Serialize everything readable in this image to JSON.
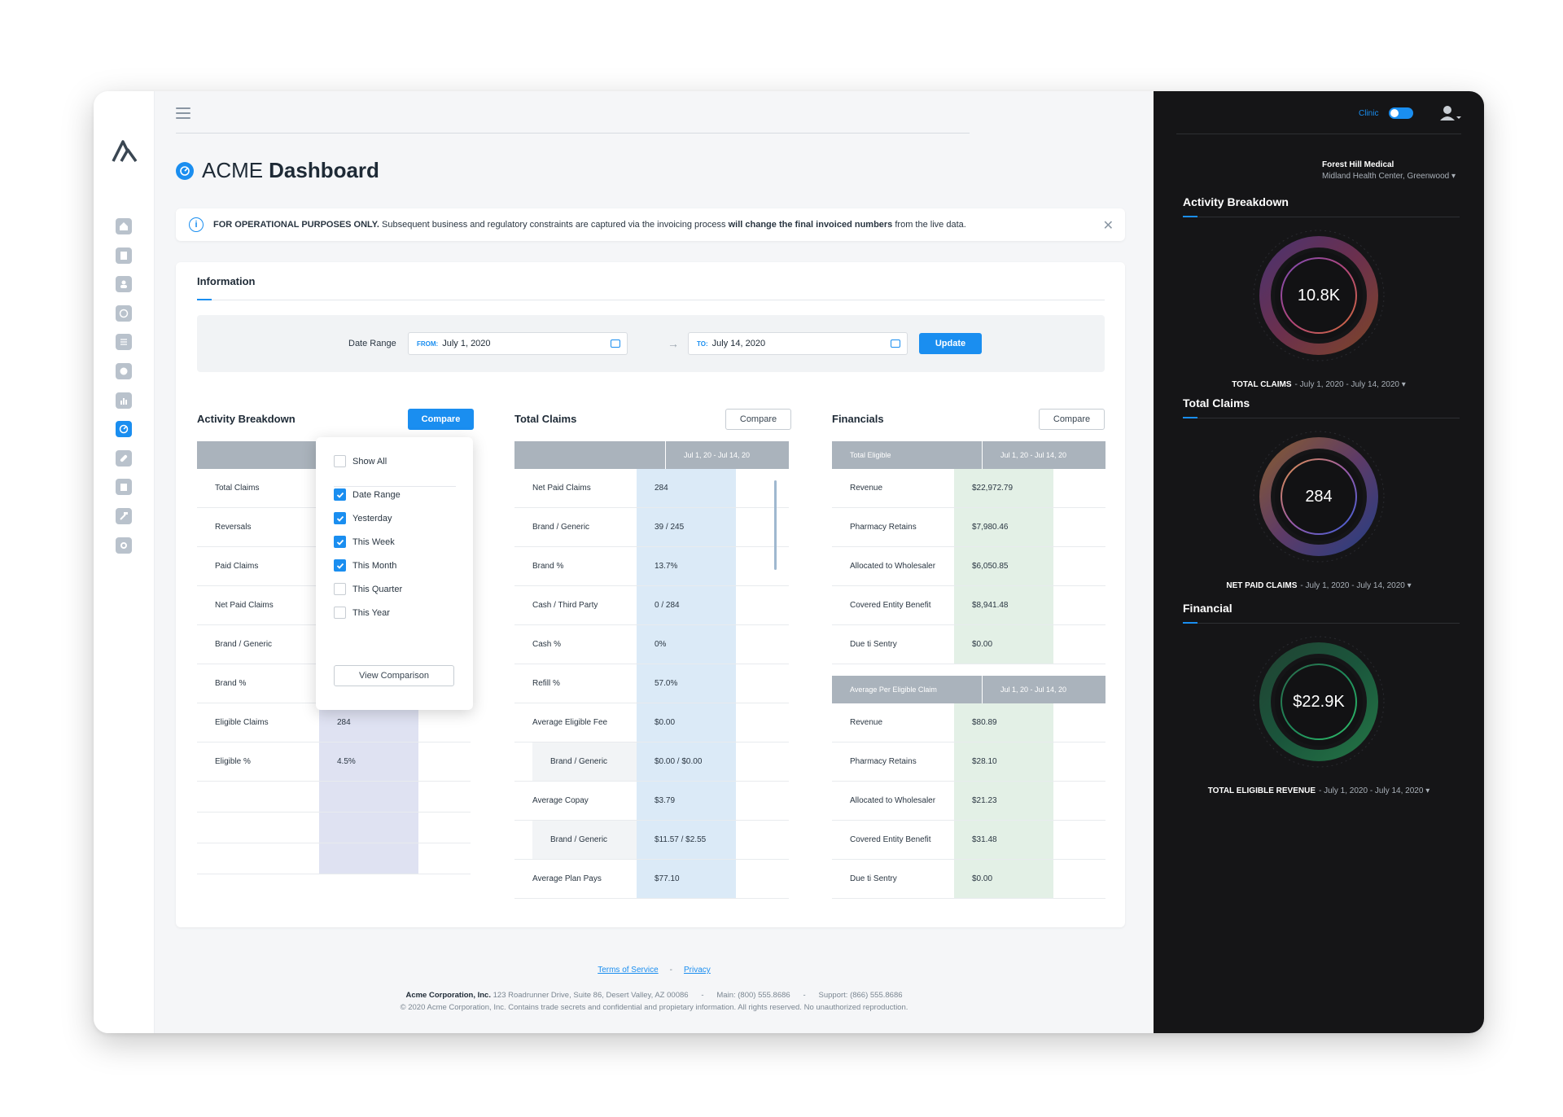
{
  "app": {
    "title_prefix": "ACME",
    "title_main": "Dashboard"
  },
  "notice": {
    "bold1": "FOR OPERATIONAL PURPOSES ONLY.",
    "text1": " Subsequent business and regulatory constraints are captured via the invoicing  process ",
    "bold2": "will change the final invoiced numbers",
    "text2": " from the live data."
  },
  "info": {
    "title": "Information",
    "date_range_label": "Date Range",
    "from_prefix": "FROM:",
    "from_value": "July 1, 2020",
    "to_prefix": "TO:",
    "to_value": "July 14, 2020",
    "update_label": "Update"
  },
  "activity": {
    "title": "Activity Breakdown",
    "compare_label": "Compare",
    "rows": [
      {
        "k": "Total Claims",
        "v": ""
      },
      {
        "k": "Reversals",
        "v": ""
      },
      {
        "k": "Paid Claims",
        "v": ""
      },
      {
        "k": "Net Paid Claims",
        "v": ""
      },
      {
        "k": "Brand / Generic",
        "v": ""
      },
      {
        "k": "Brand %",
        "v": ""
      },
      {
        "k": "Eligible Claims",
        "v": "284"
      },
      {
        "k": "Eligible %",
        "v": "4.5%"
      },
      {
        "k": "",
        "v": ""
      },
      {
        "k": "",
        "v": ""
      },
      {
        "k": "",
        "v": ""
      }
    ]
  },
  "dropdown": {
    "show_all": "Show All",
    "options": [
      {
        "label": "Date Range",
        "checked": true
      },
      {
        "label": "Yesterday",
        "checked": true
      },
      {
        "label": "This Week",
        "checked": true
      },
      {
        "label": "This Month",
        "checked": true
      },
      {
        "label": "This Quarter",
        "checked": false
      },
      {
        "label": "This Year",
        "checked": false
      }
    ],
    "view_label": "View Comparison"
  },
  "claims": {
    "title": "Total Claims",
    "compare_label": "Compare",
    "header": "Jul 1, 20 - Jul 14, 20",
    "rows": [
      {
        "k": "Net Paid Claims",
        "v": "284"
      },
      {
        "k": "Brand / Generic",
        "v": "39 / 245"
      },
      {
        "k": "Brand %",
        "v": "13.7%"
      },
      {
        "k": "Cash / Third Party",
        "v": "0 / 284"
      },
      {
        "k": "Cash %",
        "v": "0%"
      },
      {
        "k": "Refill %",
        "v": "57.0%"
      },
      {
        "k": "Average Eligible Fee",
        "v": "$0.00"
      },
      {
        "k": "Brand / Generic",
        "v": "$0.00 / $0.00",
        "sub": true
      },
      {
        "k": "Average Copay",
        "v": "$3.79"
      },
      {
        "k": "Brand / Generic",
        "v": "$11.57 / $2.55",
        "sub": true
      },
      {
        "k": "Average Plan Pays",
        "v": "$77.10"
      }
    ]
  },
  "financials": {
    "title": "Financials",
    "compare_label": "Compare",
    "header1_k": "Total Eligible",
    "header1_v": "Jul 1, 20 - Jul 14, 20",
    "rows1": [
      {
        "k": "Revenue",
        "v": "$22,972.79"
      },
      {
        "k": "Pharmacy Retains",
        "v": "$7,980.46"
      },
      {
        "k": "Allocated to Wholesaler",
        "v": "$6,050.85"
      },
      {
        "k": "Covered Entity Benefit",
        "v": "$8,941.48"
      },
      {
        "k": "Due ti Sentry",
        "v": "$0.00"
      }
    ],
    "header2_k": "Average Per Eligible Claim",
    "header2_v": "Jul 1, 20 - Jul 14, 20",
    "rows2": [
      {
        "k": "Revenue",
        "v": "$80.89"
      },
      {
        "k": "Pharmacy Retains",
        "v": "$28.10"
      },
      {
        "k": "Allocated to Wholesaler",
        "v": "$21.23"
      },
      {
        "k": "Covered Entity Benefit",
        "v": "$31.48"
      },
      {
        "k": "Due ti Sentry",
        "v": "$0.00"
      }
    ]
  },
  "footer": {
    "terms": "Terms of Service",
    "sep": "-",
    "privacy": "Privacy",
    "company": "Acme Corporation, Inc.",
    "address": " 123 Roadrunner Drive, Suite 86, Desert Valley, AZ 00086      -      Main: (800) 555.8686      -      Support: (866) 555.8686",
    "copyright": "© 2020 Acme Corporation, Inc. Contains trade secrets and confidential and propietary information. All rights reserved. No unauthorized reproduction."
  },
  "right": {
    "clinic_label": "Clinic",
    "clinic_name": "Forest Hill Medical",
    "clinic_sub": "Midland Health Center, Greenwood",
    "sections": [
      {
        "title": "Activity Breakdown",
        "value": "10.8K",
        "caption": "TOTAL CLAIMS",
        "range": "-  July 1, 2020 - July 14, 2020",
        "colors": [
          "#d06a3a",
          "#b2467a",
          "#7a4bb5"
        ]
      },
      {
        "title": "Total Claims",
        "value": "284",
        "caption": "NET PAID CLAIMS",
        "range": "-  July 1, 2020 - July 14, 2020",
        "colors": [
          "#3a5fd8",
          "#9a5aa8",
          "#e0934a"
        ]
      },
      {
        "title": "Financial",
        "value": "$22.9K",
        "caption": "TOTAL ELIGIBLE REVENUE",
        "range": "-  July 1, 2020 - July 14, 2020",
        "colors": [
          "#2fbf6a",
          "#1f8a5a",
          "#2a6a4a"
        ]
      }
    ]
  },
  "colors": {
    "accent": "#1a8ef0",
    "dark_panel": "#151517",
    "claims_col": "#dbeaf7",
    "fin_col": "#e3f0e6",
    "activity_col": "#dfe2f2"
  }
}
